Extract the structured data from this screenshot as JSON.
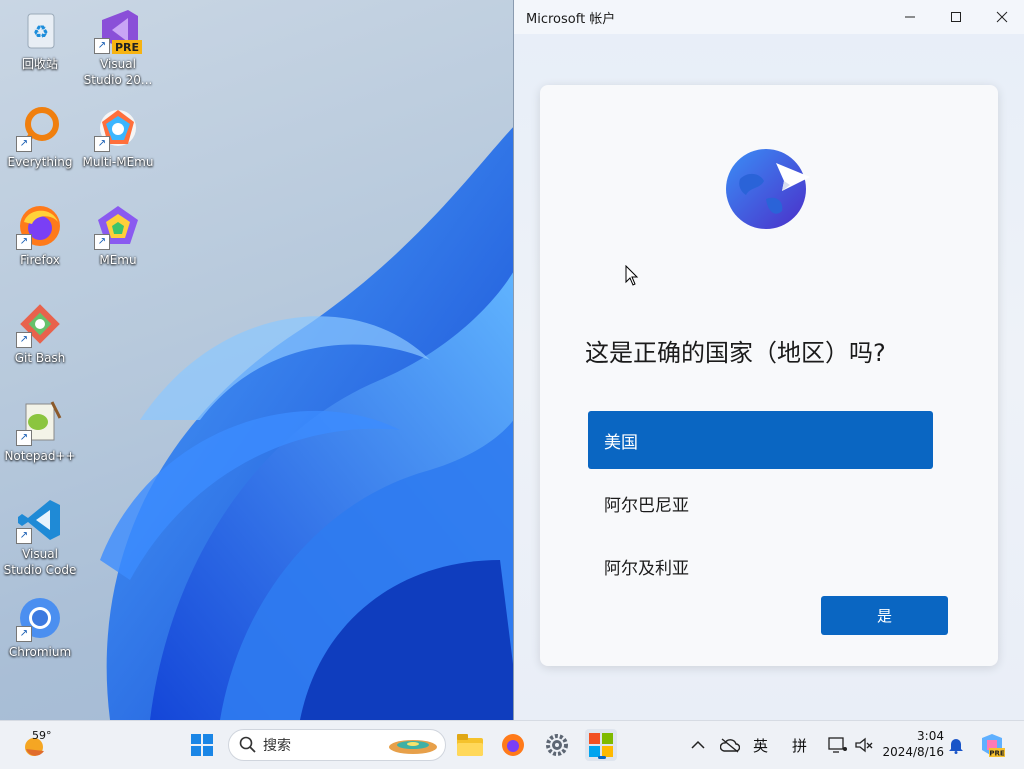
{
  "desktop": {
    "icons": [
      {
        "label": "回收站"
      },
      {
        "label": "Visual\nStudio 20...",
        "badge": "PRE"
      },
      {
        "label": "Everything"
      },
      {
        "label": "Multi-MEmu"
      },
      {
        "label": "Firefox"
      },
      {
        "label": "MEmu"
      },
      {
        "label": "Git Bash"
      },
      {
        "label": "Notepad++"
      },
      {
        "label": "Visual\nStudio Code"
      },
      {
        "label": "Chromium"
      }
    ]
  },
  "window": {
    "title": "Microsoft 帐户",
    "controls": {
      "minimize": "—",
      "maximize": "☐",
      "close": "✕"
    },
    "question": "这是正确的国家（地区）吗?",
    "countries": [
      {
        "label": "美国",
        "selected": true
      },
      {
        "label": "阿尔巴尼亚",
        "selected": false
      },
      {
        "label": "阿尔及利亚",
        "selected": false
      }
    ],
    "confirm_label": "是",
    "accent": "#0a66c2"
  },
  "taskbar": {
    "weather_temp": "59°",
    "search_placeholder": "搜索",
    "apps": [
      "start-icon",
      "file-explorer-icon",
      "firefox-icon",
      "settings-icon",
      "microsoft-store-icon"
    ],
    "tray": {
      "ime_lang": "英",
      "ime_mode": "拼"
    },
    "time": "3:04",
    "date": "2024/8/16"
  }
}
